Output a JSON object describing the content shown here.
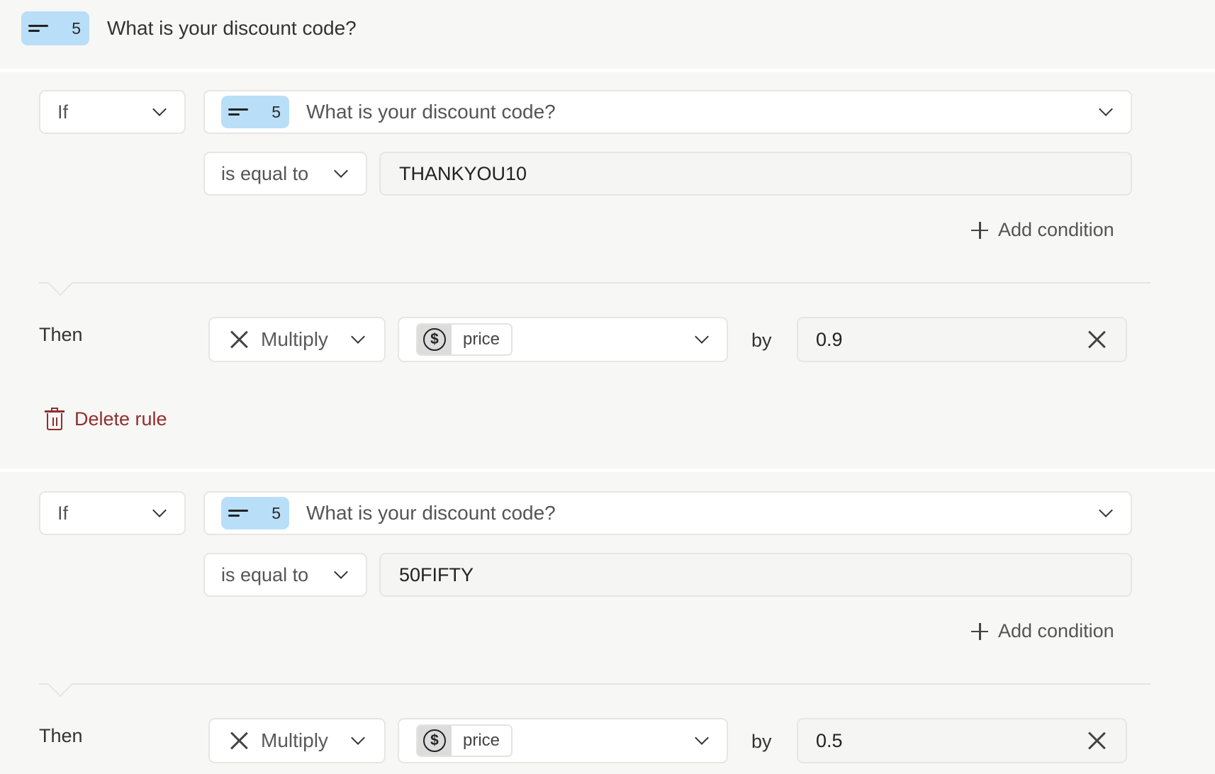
{
  "header": {
    "question_number": "5",
    "question_title": "What is your discount code?"
  },
  "rules": [
    {
      "if_label": "If",
      "question": {
        "number": "5",
        "title": "What is your discount code?"
      },
      "operator": "is equal to",
      "value": "THANKYOU10",
      "add_condition_label": "Add condition",
      "then_label": "Then",
      "action": "Multiply",
      "variable": "price",
      "by_label": "by",
      "amount": "0.9",
      "delete_label": "Delete rule"
    },
    {
      "if_label": "If",
      "question": {
        "number": "5",
        "title": "What is your discount code?"
      },
      "operator": "is equal to",
      "value": "50FIFTY",
      "add_condition_label": "Add condition",
      "then_label": "Then",
      "action": "Multiply",
      "variable": "price",
      "by_label": "by",
      "amount": "0.5"
    }
  ],
  "colors": {
    "badge": "#b9def8",
    "delete": "#8f2f2f",
    "background": "#f7f7f5"
  }
}
